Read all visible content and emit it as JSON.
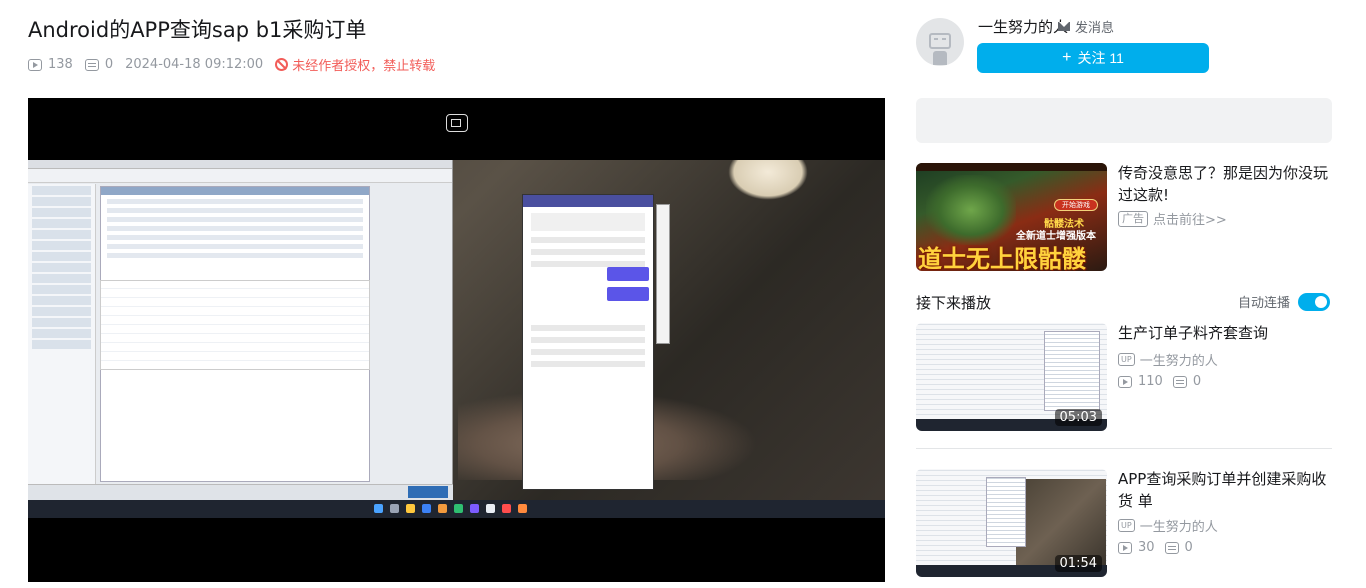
{
  "video": {
    "title": "Android的APP查询sap b1采购订单",
    "views": "138",
    "danmaku": "0",
    "pubdate": "2024-04-18 09:12:00",
    "copyright": "未经作者授权，禁止转载"
  },
  "uploader": {
    "name": "一生努力的人",
    "message_label": "发消息",
    "follow_label": "关注 11"
  },
  "ad": {
    "title": "传奇没意思了？那是因为你没玩过这款!",
    "tag": "广告",
    "action": "点击前往>>",
    "thumb_start": "开始游戏",
    "thumb_sub1": "骷髅法术",
    "thumb_sub2": "全新道士增强版本",
    "thumb_big": "道士无上限骷髅"
  },
  "recommend": {
    "label": "接下来播放",
    "autoplay_label": "自动连播",
    "autoplay_on": true,
    "items": [
      {
        "title": "生产订单子料齐套查询",
        "up": "一生努力的人",
        "views": "110",
        "danmaku": "0",
        "duration": "05:03"
      },
      {
        "title": "APP查询采购订单并创建采购收货 单",
        "up": "一生努力的人",
        "views": "30",
        "danmaku": "0",
        "duration": "01:54"
      }
    ]
  },
  "colors": {
    "accent": "#00aeec",
    "warning": "#f25d59",
    "muted": "#9499a0"
  }
}
